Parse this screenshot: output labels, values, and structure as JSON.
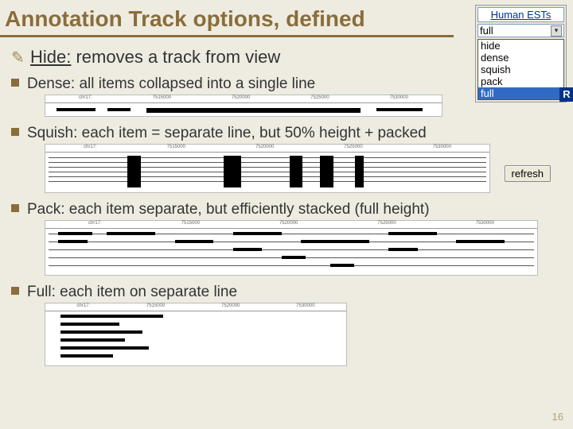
{
  "title": "Annotation Track options, defined",
  "hide": {
    "label": "Hide:",
    "desc": "removes a track from view"
  },
  "items": [
    {
      "text": "Dense: all items collapsed into a single line"
    },
    {
      "text": "Squish: each item = separate line, but 50% height + packed"
    },
    {
      "text": "Pack: each item separate, but efficiently stacked (full height)"
    },
    {
      "text": "Full: each item on separate line"
    }
  ],
  "dropdown": {
    "header": "Human ESTs",
    "selected": "full",
    "options": [
      "hide",
      "dense",
      "squish",
      "pack",
      "full"
    ]
  },
  "r_badge": "R",
  "refresh": "refresh",
  "page": "16",
  "ruler_ticks": [
    "chr17:",
    "7515000",
    "7520000",
    "7525000",
    "7530000"
  ]
}
